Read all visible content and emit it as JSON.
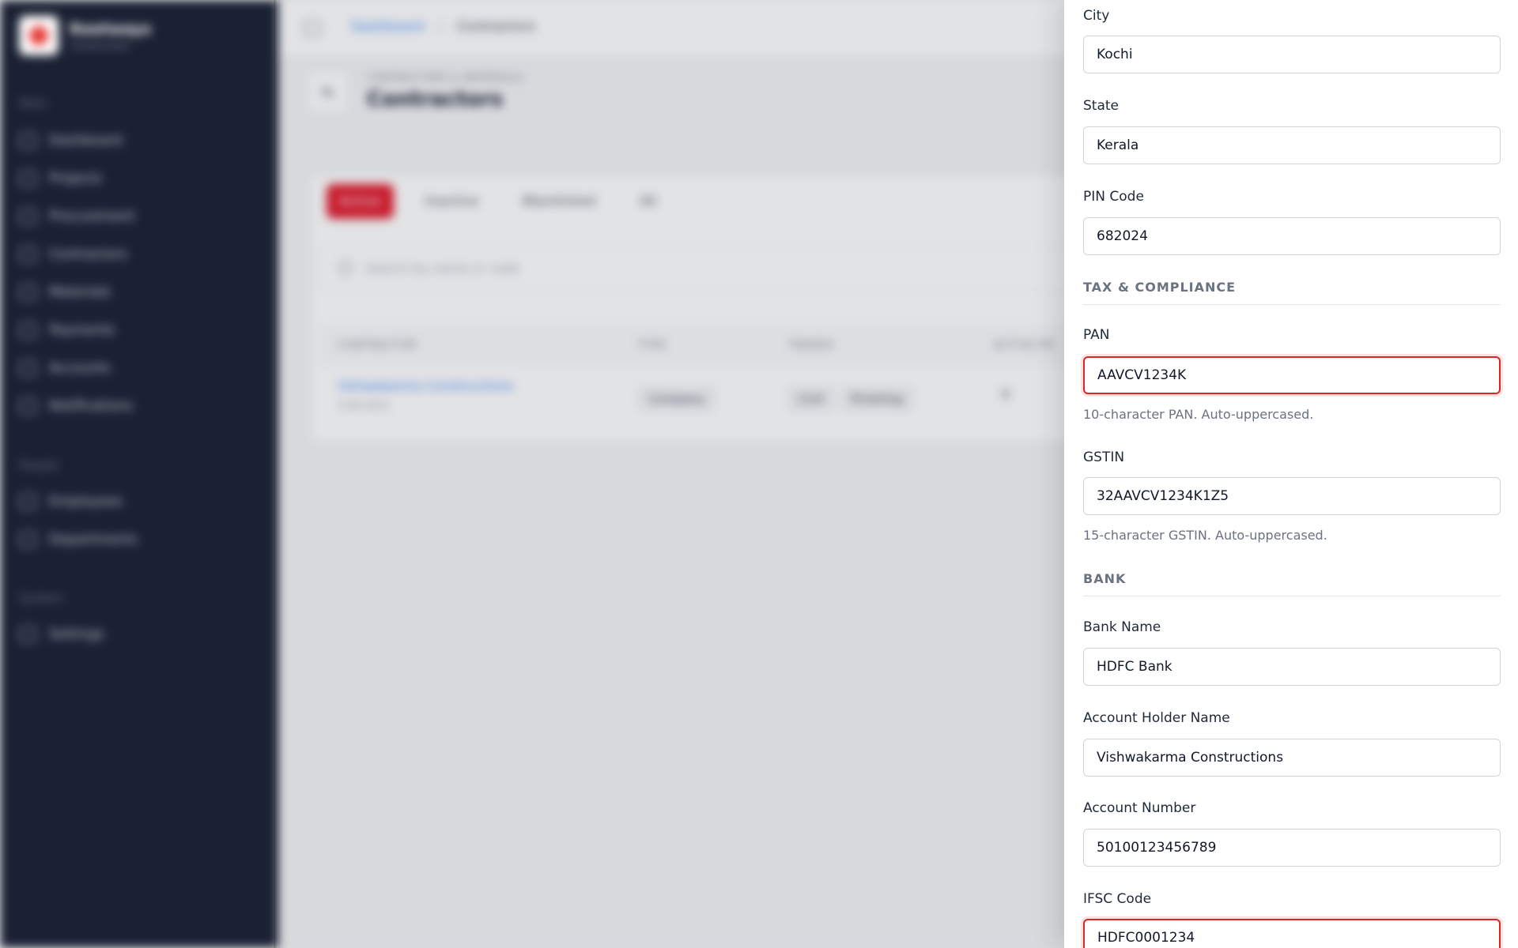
{
  "sidebar": {
    "brand": {
      "name": "Rootways",
      "subtitle": "Construction"
    },
    "sections": [
      {
        "title": "Main",
        "items": [
          "Dashboard",
          "Projects",
          "Procurement",
          "Contractors",
          "Materials",
          "Payments",
          "Accounts",
          "Notifications"
        ]
      },
      {
        "title": "People",
        "items": [
          "Employees",
          "Departments"
        ]
      },
      {
        "title": "System",
        "items": [
          "Settings"
        ]
      }
    ]
  },
  "header": {
    "breadcrumb": {
      "root": "Dashboard",
      "separator": "/",
      "current": "Contractors"
    },
    "kicker": "CONTRACTORS & MATERIALS",
    "title": "Contractors"
  },
  "list": {
    "tabs": [
      "Active",
      "Inactive",
      "Blacklisted",
      "All"
    ],
    "search_placeholder": "Search by name or code",
    "columns": [
      "CONTRACTOR",
      "TYPE",
      "TRADES",
      "ACTIVE PR"
    ],
    "rows": [
      {
        "name": "Vishwakarma Constructions",
        "code": "CON-0001",
        "type": "Company",
        "trades": [
          "Civil",
          "Finishing"
        ],
        "active": "0"
      }
    ]
  },
  "form": {
    "city": {
      "label": "City",
      "value": "Kochi"
    },
    "state": {
      "label": "State",
      "value": "Kerala"
    },
    "pin": {
      "label": "PIN Code",
      "value": "682024"
    },
    "tax_section": "TAX & COMPLIANCE",
    "pan": {
      "label": "PAN",
      "value": "AAVCV1234K",
      "help": "10-character PAN. Auto-uppercased."
    },
    "gstin": {
      "label": "GSTIN",
      "value": "32AAVCV1234K1Z5",
      "help": "15-character GSTIN. Auto-uppercased."
    },
    "bank_section": "BANK",
    "bank_name": {
      "label": "Bank Name",
      "value": "HDFC Bank"
    },
    "holder": {
      "label": "Account Holder Name",
      "value": "Vishwakarma Constructions"
    },
    "account_number": {
      "label": "Account Number",
      "value": "50100123456789"
    },
    "ifsc": {
      "label": "IFSC Code",
      "value": "HDFC0001234"
    }
  },
  "colors": {
    "accent": "#e11d2e",
    "error": "#dc2626",
    "sidebar": "#1a2133"
  }
}
